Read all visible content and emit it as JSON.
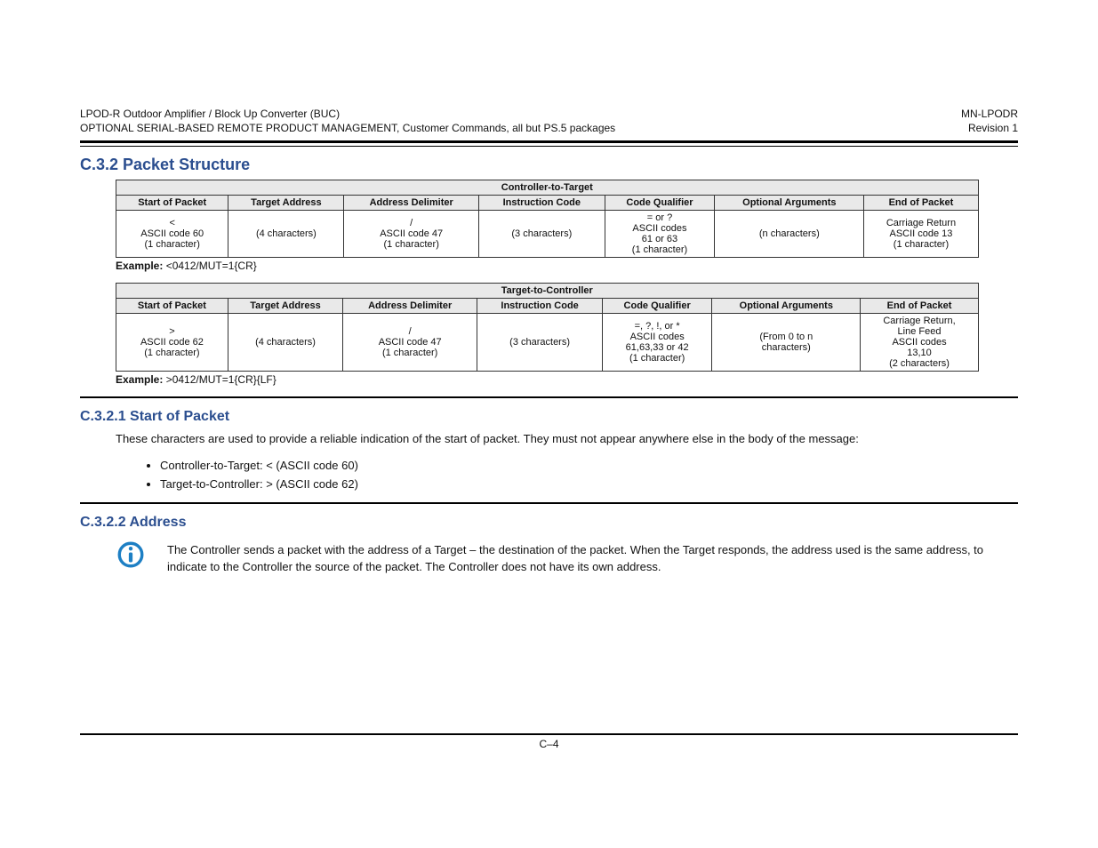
{
  "header": {
    "left_line1": "LPOD-R Outdoor Amplifier / Block Up Converter (BUC)",
    "left_line2": "OPTIONAL SERIAL-BASED REMOTE PRODUCT MANAGEMENT, Customer Commands, all but PS.5 packages",
    "right_line1": "MN-LPODR",
    "right_line2": "Revision 1"
  },
  "section": {
    "num_title": "C.3.2  Packet Structure"
  },
  "table1": {
    "group_title": "Controller-to-Target",
    "headers": [
      "Start of Packet",
      "Target Address",
      "Address Delimiter",
      "Instruction Code",
      "Code Qualifier",
      "Optional Arguments",
      "End of Packet"
    ],
    "row1": [
      "<",
      "",
      "/",
      "",
      "= or ?",
      "",
      "Carriage Return"
    ],
    "row2": [
      "ASCII code 60",
      "",
      "ASCII code 47",
      "",
      "ASCII codes",
      "",
      "ASCII code 13"
    ],
    "row3": [
      "",
      "",
      "",
      "",
      "61 or 63",
      "",
      ""
    ],
    "row_counts": [
      "(1 character)",
      "(4 characters)",
      "(1 character)",
      "(3 characters)",
      "(1 character)",
      "(n characters)",
      "(1 character)"
    ]
  },
  "example1_label": "Example:",
  "example1_value": " <0412/MUT=1{CR}",
  "table2": {
    "group_title": "Target-to-Controller",
    "headers": [
      "Start of Packet",
      "Target Address",
      "Address Delimiter",
      "Instruction Code",
      "Code Qualifier",
      "Optional Arguments",
      "End of Packet"
    ],
    "row1": [
      ">",
      "",
      "/",
      "",
      "=, ?, !, or *",
      "",
      "Carriage Return,"
    ],
    "row2": [
      "ASCII code 62",
      "",
      "ASCII code 47",
      "",
      "ASCII codes",
      "",
      "Line Feed"
    ],
    "row3": [
      "",
      "",
      "",
      "",
      "61,63,33 or 42",
      "",
      "ASCII codes"
    ],
    "row4": [
      "",
      "",
      "",
      "",
      "",
      "(From 0 to n",
      "13,10"
    ],
    "row_counts": [
      "(1 character)",
      "(4 characters)",
      "(1 character)",
      "(3 characters)",
      "(1 character)",
      "characters)",
      "(2 characters)"
    ]
  },
  "example2_label": "Example:",
  "example2_value": " >0412/MUT=1{CR}{LF}",
  "sub1": {
    "num_title": "C.3.2.1  Start of Packet",
    "para": "These characters are used to provide a reliable indication of the start of packet. They must not appear anywhere else in the body of the message:",
    "bullets": [
      "Controller-to-Target: <  (ASCII code 60)",
      "Target-to-Controller: >  (ASCII code 62)"
    ]
  },
  "sub2": {
    "num_title": "C.3.2.2  Address",
    "para": "The Controller sends a packet with the address of a Target – the destination of the packet. When the Target responds, the address used is the same address, to indicate to the Controller the source of the packet. The Controller does not have its own address."
  },
  "footer": "C–4"
}
